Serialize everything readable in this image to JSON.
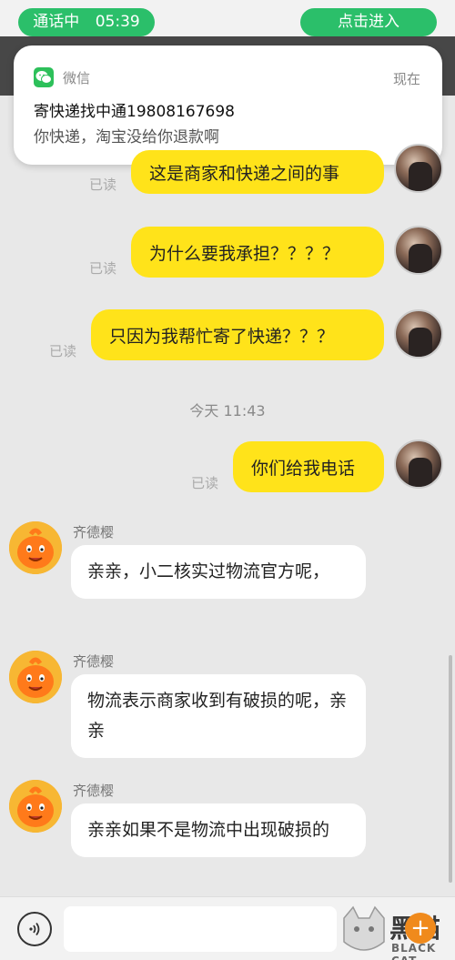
{
  "status": {
    "call_label": "通话中",
    "call_time": "05:39",
    "enter_label": "点击进入"
  },
  "notification": {
    "app_name": "微信",
    "time": "现在",
    "title": "寄快递找中通19808167698",
    "body": "你快递，淘宝没给你退款啊"
  },
  "messages_out": [
    {
      "text": "这是商家和快递之间的事",
      "status": "已读"
    },
    {
      "text": "为什么要我承担？？？？",
      "status": "已读"
    },
    {
      "text": "只因为我帮忙寄了快递？？？",
      "status": "已读"
    },
    {
      "text": "你们给我电话",
      "status": "已读"
    }
  ],
  "timestamp": "今天 11:43",
  "messages_in": [
    {
      "sender": "齐德樱",
      "text": "亲亲，小二核实过物流官方呢，"
    },
    {
      "sender": "齐德樱",
      "text": "物流表示商家收到有破损的呢，亲亲"
    },
    {
      "sender": "齐德樱",
      "text": "亲亲如果不是物流中出现破损的"
    }
  ],
  "input": {
    "placeholder": "",
    "add_label": "+"
  },
  "watermark": {
    "text": "BLACK CAT",
    "glyph": "黑猫"
  },
  "colors": {
    "accent_green": "#2bbf6a",
    "bubble_out": "#ffe31a",
    "bubble_in": "#ffffff",
    "background": "#e8e8e8"
  }
}
